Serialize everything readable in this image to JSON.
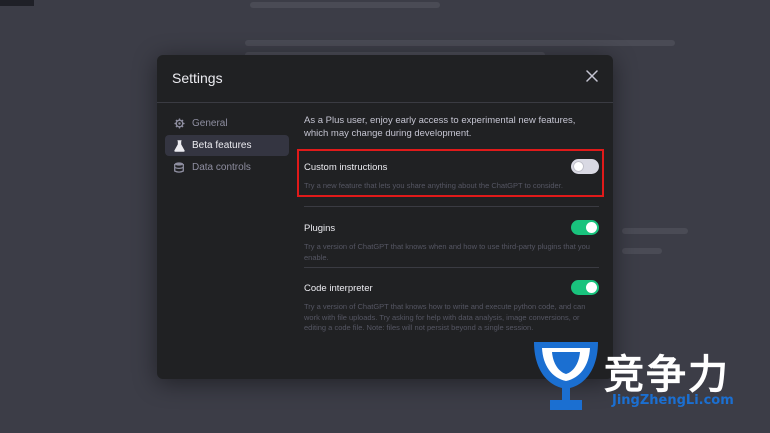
{
  "modal": {
    "title": "Settings",
    "close_icon": "close-icon"
  },
  "sidebar": {
    "items": [
      {
        "label": "General",
        "icon": "gear-icon",
        "active": false
      },
      {
        "label": "Beta features",
        "icon": "flask-icon",
        "active": true
      },
      {
        "label": "Data controls",
        "icon": "database-icon",
        "active": false
      }
    ]
  },
  "content": {
    "intro": "As a Plus user, enjoy early access to experimental new features, which may change during development.",
    "features": [
      {
        "label": "Custom instructions",
        "description": "Try a new feature that lets you share anything about the ChatGPT to consider.",
        "enabled": false
      },
      {
        "label": "Plugins",
        "description": "Try a version of ChatGPT that knows when and how to use third-party plugins that you enable.",
        "enabled": true
      },
      {
        "label": "Code interpreter",
        "description": "Try a version of ChatGPT that knows how to write and execute python code, and can work with file uploads. Try asking for help with data analysis, image conversions, or editing a code file. Note: files will not persist beyond a single session.",
        "enabled": true
      }
    ]
  },
  "watermark": {
    "text_cn": "竞争力",
    "text_en": "JingZhengLi.com"
  },
  "colors": {
    "toggle_on": "#19c37d",
    "toggle_off": "#d9d9e3",
    "highlight": "#e01a1a",
    "modal_bg": "#202123"
  }
}
